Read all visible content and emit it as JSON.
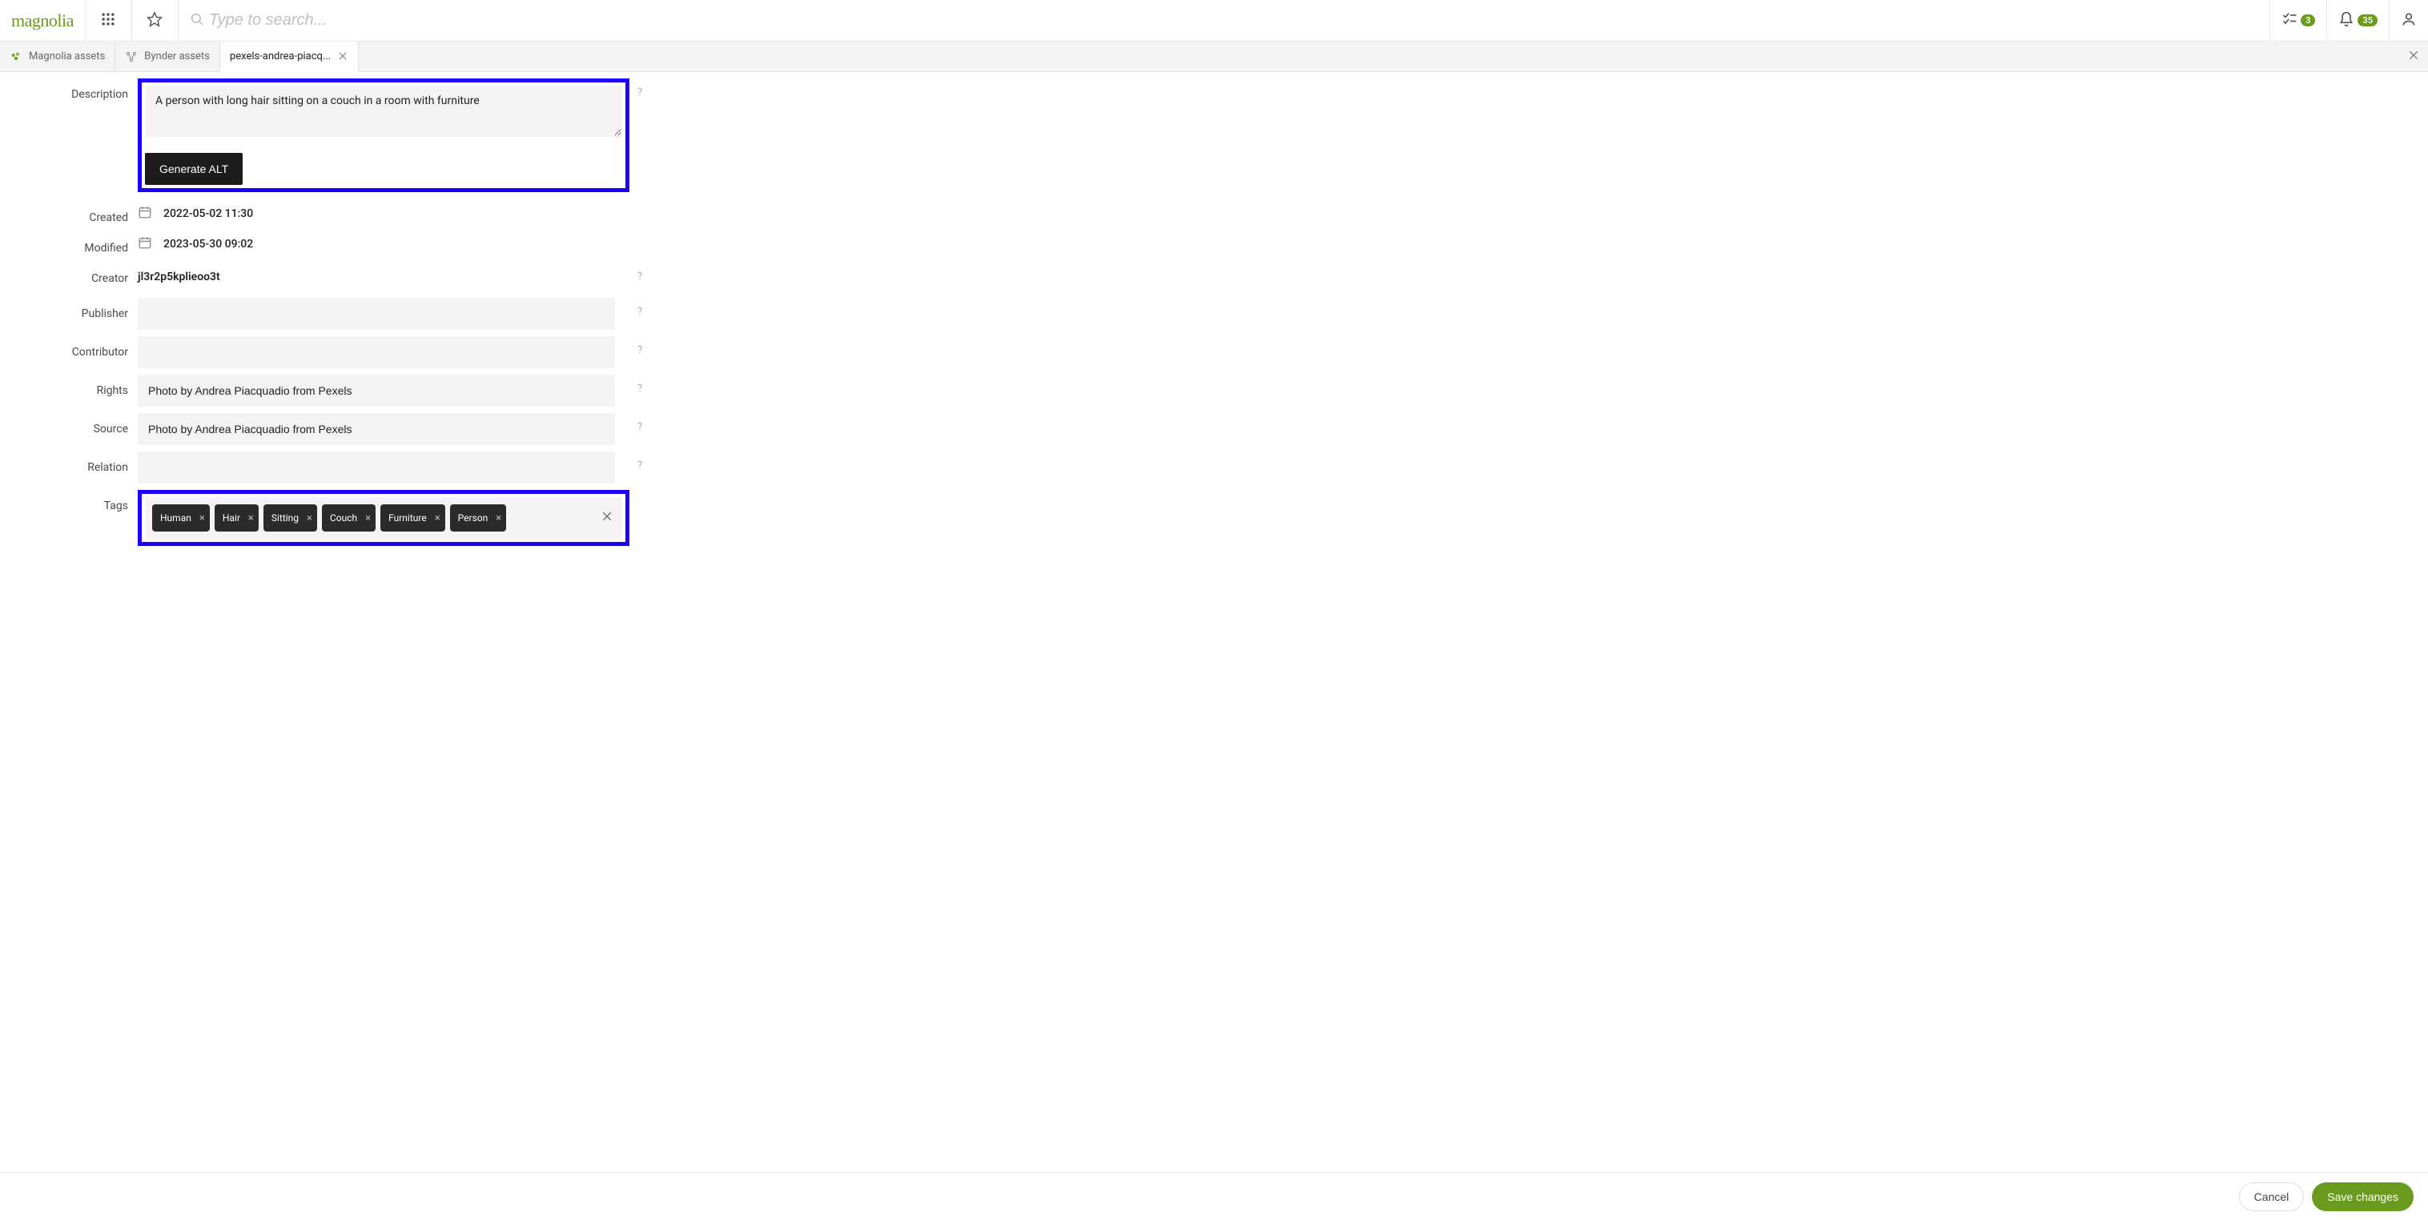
{
  "header": {
    "logo_text": "magnolia",
    "search_placeholder": "Type to search...",
    "tasks_badge": "3",
    "notifications_badge": "35"
  },
  "tabs": {
    "items": [
      {
        "label": "Magnolia assets"
      },
      {
        "label": "Bynder assets"
      },
      {
        "label": "pexels-andrea-piacq..."
      }
    ]
  },
  "form": {
    "description_label": "Description",
    "description_value": "A person with long hair sitting on a couch in a room with furniture",
    "generate_alt_label": "Generate ALT",
    "created_label": "Created",
    "created_value": "2022-05-02 11:30",
    "modified_label": "Modified",
    "modified_value": "2023-05-30 09:02",
    "creator_label": "Creator",
    "creator_value": "jl3r2p5kplieoo3t",
    "publisher_label": "Publisher",
    "publisher_value": "",
    "contributor_label": "Contributor",
    "contributor_value": "",
    "rights_label": "Rights",
    "rights_value": "Photo by Andrea Piacquadio from Pexels",
    "source_label": "Source",
    "source_value": "Photo by Andrea Piacquadio from Pexels",
    "relation_label": "Relation",
    "relation_value": "",
    "tags_label": "Tags",
    "tags": [
      "Human",
      "Hair",
      "Sitting",
      "Couch",
      "Furniture",
      "Person"
    ],
    "help_char": "?",
    "tag_remove_char": "×"
  },
  "footer": {
    "cancel_label": "Cancel",
    "save_label": "Save changes"
  }
}
